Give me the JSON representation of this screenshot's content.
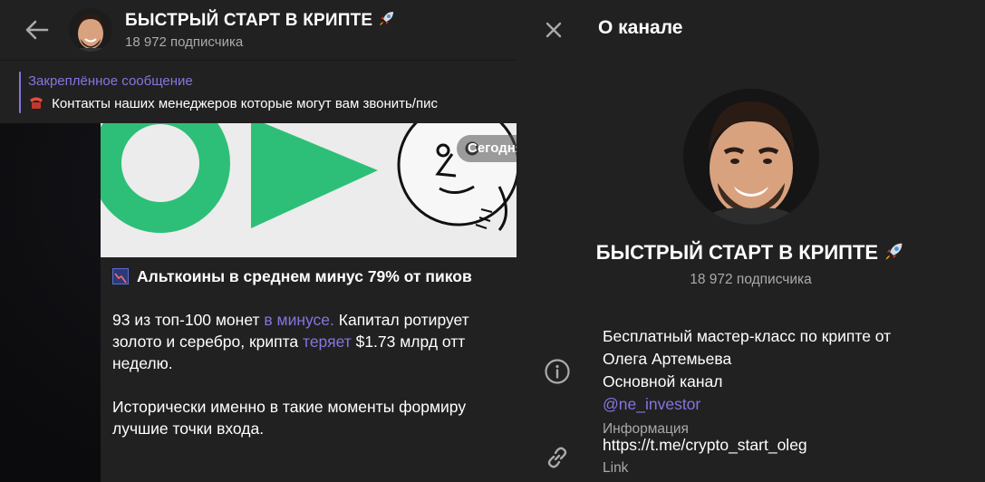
{
  "chat": {
    "title": "БЫСТРЫЙ СТАРТ В КРИПТЕ",
    "subtitle": "18 972 подписчика",
    "pinned": {
      "label": "Закреплённое сообщение",
      "text": "Контакты наших менеджеров которые могут вам звонить/пис"
    },
    "date_badge": "Сегодня",
    "message": {
      "headline": "Альткоины в среднем минус 79% от пиков",
      "p1_line1_a": "93 из топ-100 монет ",
      "p1_line1_link": "в минусе.",
      "p1_line1_b": " Капитал ротирует",
      "p1_line2_a": "золото и серебро, крипта ",
      "p1_line2_link": "теряет",
      "p1_line2_b": " $1.73 млрд отт",
      "p1_line3": "неделю.",
      "p2_line1": "Исторически именно в такие моменты формиру",
      "p2_line2": "лучшие точки входа."
    }
  },
  "panel": {
    "title": "О канале",
    "name": "БЫСТРЫЙ СТАРТ В КРИПТЕ",
    "subscribers": "18 972 подписчика",
    "description": {
      "line1": "Бесплатный мастер-класс по крипте от",
      "line2": "Олега Артемьева",
      "line3_a": "Основной канал ",
      "line3_link": "@ne_investor",
      "caption": "Информация"
    },
    "link": {
      "value": "https://t.me/crypto_start_oleg",
      "caption": "Link"
    }
  },
  "icons": {
    "back": "arrow-left-icon",
    "close": "close-icon",
    "info": "info-icon",
    "link": "link-icon",
    "rocket": "rocket-emoji-icon",
    "phone": "telephone-emoji-icon",
    "chart": "chart-decreasing-emoji-icon"
  },
  "colors": {
    "accent": "#8774e1",
    "panel_bg": "#212121",
    "muted": "#aaaaaa",
    "brand_green": "#2dbf77"
  }
}
